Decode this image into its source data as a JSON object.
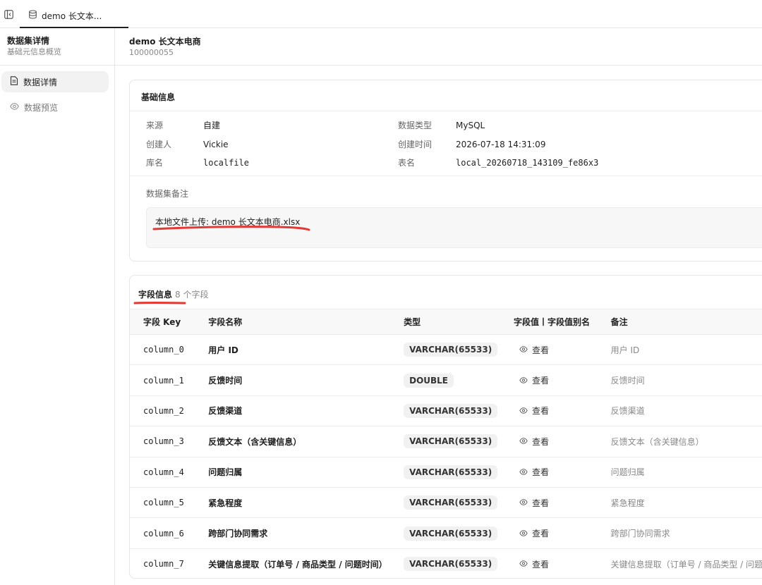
{
  "tabbar": {
    "tab_label": "demo 长文本..."
  },
  "sidebar": {
    "title": "数据集详情",
    "subtitle": "基础元信息概览",
    "items": [
      {
        "label": "数据详情",
        "icon": "document-icon",
        "active": true
      },
      {
        "label": "数据预览",
        "icon": "eye-icon",
        "active": false
      }
    ]
  },
  "header": {
    "title": "demo 长文本电商",
    "id": "100000055"
  },
  "basic_info": {
    "title": "基础信息",
    "fields": {
      "source_label": "来源",
      "source_value": "自建",
      "creator_label": "创建人",
      "creator_value": "Vickie",
      "db_label": "库名",
      "db_value": "localfile",
      "dtype_label": "数据类型",
      "dtype_value": "MySQL",
      "ctime_label": "创建时间",
      "ctime_value": "2026-07-18 14:31:09",
      "table_label": "表名",
      "table_value": "local_20260718_143109_fe86x3"
    },
    "note_label": "数据集备注",
    "note_value": "本地文件上传: demo 长文本电商.xlsx"
  },
  "fields_section": {
    "title": "字段信息",
    "count": "8 个字段",
    "headers": [
      "字段 Key",
      "字段名称",
      "类型",
      "字段值丨字段值别名",
      "备注"
    ],
    "view_label": "查看",
    "rows": [
      {
        "key": "column_0",
        "name": "用户 ID",
        "type": "VARCHAR(65533)",
        "note": "用户 ID"
      },
      {
        "key": "column_1",
        "name": "反馈时间",
        "type": "DOUBLE",
        "note": "反馈时间"
      },
      {
        "key": "column_2",
        "name": "反馈渠道",
        "type": "VARCHAR(65533)",
        "note": "反馈渠道"
      },
      {
        "key": "column_3",
        "name": "反馈文本（含关键信息）",
        "type": "VARCHAR(65533)",
        "note": "反馈文本（含关键信息）"
      },
      {
        "key": "column_4",
        "name": "问题归属",
        "type": "VARCHAR(65533)",
        "note": "问题归属"
      },
      {
        "key": "column_5",
        "name": "紧急程度",
        "type": "VARCHAR(65533)",
        "note": "紧急程度"
      },
      {
        "key": "column_6",
        "name": "跨部门协同需求",
        "type": "VARCHAR(65533)",
        "note": "跨部门协同需求"
      },
      {
        "key": "column_7",
        "name": "关键信息提取（订单号 / 商品类型 / 问题时间）",
        "type": "VARCHAR(65533)",
        "note": "关键信息提取（订单号 / 商品类型 / 问题时"
      }
    ]
  },
  "colors": {
    "annotation": "#e53935",
    "border": "#e6e6e6",
    "active_bg": "#f2f2f2"
  }
}
